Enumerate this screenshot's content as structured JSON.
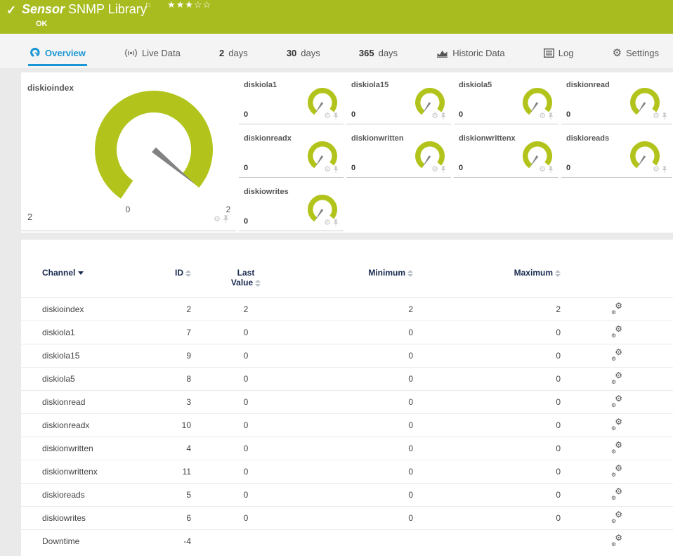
{
  "header": {
    "check_icon": "✓",
    "title_prefix": "Sensor",
    "title": "SNMP Library",
    "flag_icon": "⚐",
    "stars": "★★★☆☆",
    "status": "OK",
    "bar_color": "#a8bc20"
  },
  "tabs": [
    {
      "label": "Overview",
      "active": true
    },
    {
      "label": "Live Data"
    },
    {
      "num": "2",
      "label": "days"
    },
    {
      "num": "30",
      "label": "days"
    },
    {
      "num": "365",
      "label": "days"
    },
    {
      "label": "Historic Data"
    },
    {
      "label": "Log"
    },
    {
      "label": "Settings"
    }
  ],
  "colors": {
    "gauge_green": "#b2c41c",
    "needle_gray": "#828282",
    "active_tab_blue": "#1a96d4"
  },
  "gauges": {
    "primary": {
      "name": "diskioindex",
      "value": 2,
      "min": 0,
      "max": 2,
      "min_label": "0",
      "max_label": "2",
      "value_label": "2"
    },
    "small": [
      {
        "name": "diskiola1",
        "value": 0,
        "min": 0,
        "max": 2,
        "value_label": "0"
      },
      {
        "name": "diskiola15",
        "value": 0,
        "min": 0,
        "max": 2,
        "value_label": "0"
      },
      {
        "name": "diskiola5",
        "value": 0,
        "min": 0,
        "max": 2,
        "value_label": "0"
      },
      {
        "name": "diskionread",
        "value": 0,
        "min": 0,
        "max": 2,
        "value_label": "0"
      },
      {
        "name": "diskionreadx",
        "value": 0,
        "min": 0,
        "max": 2,
        "value_label": "0"
      },
      {
        "name": "diskionwritten",
        "value": 0,
        "min": 0,
        "max": 2,
        "value_label": "0"
      },
      {
        "name": "diskionwrittenx",
        "value": 0,
        "min": 0,
        "max": 2,
        "value_label": "0"
      },
      {
        "name": "diskioreads",
        "value": 0,
        "min": 0,
        "max": 2,
        "value_label": "0"
      },
      {
        "name": "diskiowrites",
        "value": 0,
        "min": 0,
        "max": 2,
        "value_label": "0"
      }
    ]
  },
  "table": {
    "columns": {
      "channel": "Channel",
      "id": "ID",
      "last_line1": "Last",
      "last_line2": "Value",
      "minimum": "Minimum",
      "maximum": "Maximum"
    },
    "rows": [
      {
        "channel": "diskioindex",
        "id": "2",
        "last": "2",
        "min": "2",
        "max": "2"
      },
      {
        "channel": "diskiola1",
        "id": "7",
        "last": "0",
        "min": "0",
        "max": "0"
      },
      {
        "channel": "diskiola15",
        "id": "9",
        "last": "0",
        "min": "0",
        "max": "0"
      },
      {
        "channel": "diskiola5",
        "id": "8",
        "last": "0",
        "min": "0",
        "max": "0"
      },
      {
        "channel": "diskionread",
        "id": "3",
        "last": "0",
        "min": "0",
        "max": "0"
      },
      {
        "channel": "diskionreadx",
        "id": "10",
        "last": "0",
        "min": "0",
        "max": "0"
      },
      {
        "channel": "diskionwritten",
        "id": "4",
        "last": "0",
        "min": "0",
        "max": "0"
      },
      {
        "channel": "diskionwrittenx",
        "id": "11",
        "last": "0",
        "min": "0",
        "max": "0"
      },
      {
        "channel": "diskioreads",
        "id": "5",
        "last": "0",
        "min": "0",
        "max": "0"
      },
      {
        "channel": "diskiowrites",
        "id": "6",
        "last": "0",
        "min": "0",
        "max": "0"
      },
      {
        "channel": "Downtime",
        "id": "-4",
        "last": "",
        "min": "",
        "max": ""
      }
    ]
  }
}
